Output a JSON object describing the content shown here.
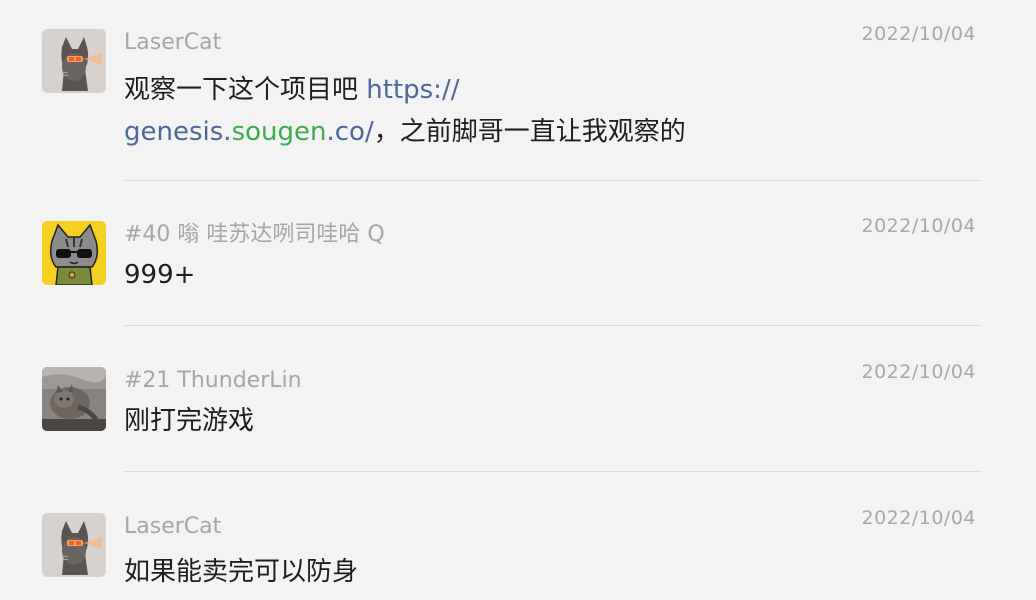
{
  "messages": [
    {
      "sender": "LaserCat",
      "date": "2022/10/04",
      "avatar_icon": "laser-cat-avatar",
      "text_pre": "观察一下这个项目吧 ",
      "link_line1": "https://",
      "link_part1": "genesis.",
      "link_part2": "sougen",
      "link_part3": ".co/",
      "text_post": "，之前脚哥一直让我观察的"
    },
    {
      "sender": "#40 嗡 哇苏达咧司哇哈 Q",
      "date": "2022/10/04",
      "avatar_icon": "sunglasses-cat-avatar",
      "text": "999+"
    },
    {
      "sender": "#21 ThunderLin",
      "date": "2022/10/04",
      "avatar_icon": "cat-photo-avatar",
      "text": "刚打完游戏"
    },
    {
      "sender": "LaserCat",
      "date": "2022/10/04",
      "avatar_icon": "laser-cat-avatar",
      "text": "如果能卖完可以防身"
    }
  ],
  "colors": {
    "background": "#f3f3f3",
    "link": "#4d6899",
    "link_highlight": "#3fab4f",
    "meta_text": "#a6a6a6"
  }
}
